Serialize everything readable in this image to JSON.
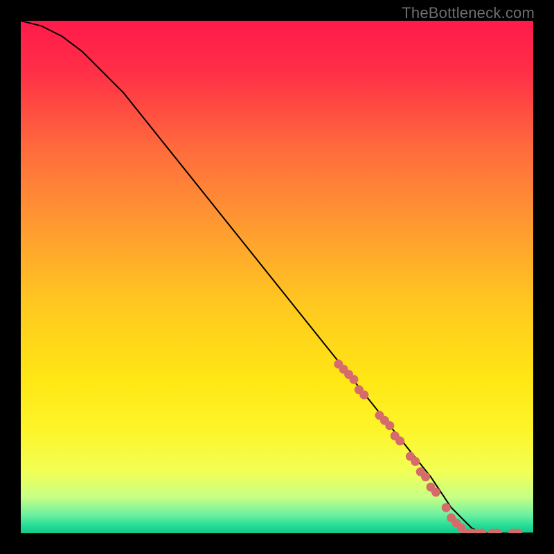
{
  "watermark": "TheBottleneck.com",
  "chart_data": {
    "type": "line",
    "title": "",
    "xlabel": "",
    "ylabel": "",
    "xlim": [
      0,
      100
    ],
    "ylim": [
      0,
      100
    ],
    "grid": false,
    "legend": false,
    "series": [
      {
        "name": "curve",
        "x": [
          0,
          4,
          8,
          12,
          16,
          20,
          24,
          28,
          32,
          36,
          40,
          44,
          48,
          52,
          56,
          60,
          64,
          68,
          72,
          76,
          80,
          82,
          84,
          86,
          88,
          90,
          92,
          94,
          96,
          98,
          100
        ],
        "y": [
          100,
          99,
          97,
          94,
          90,
          86,
          81,
          76,
          71,
          66,
          61,
          56,
          51,
          46,
          41,
          36,
          31,
          26,
          21,
          16,
          11,
          8,
          5,
          3,
          1,
          0,
          0,
          0,
          0,
          0,
          0
        ]
      }
    ],
    "markers": [
      {
        "x": 62,
        "y": 33
      },
      {
        "x": 63,
        "y": 32
      },
      {
        "x": 64,
        "y": 31
      },
      {
        "x": 65,
        "y": 30
      },
      {
        "x": 66,
        "y": 28
      },
      {
        "x": 67,
        "y": 27
      },
      {
        "x": 70,
        "y": 23
      },
      {
        "x": 71,
        "y": 22
      },
      {
        "x": 72,
        "y": 21
      },
      {
        "x": 73,
        "y": 19
      },
      {
        "x": 74,
        "y": 18
      },
      {
        "x": 76,
        "y": 15
      },
      {
        "x": 77,
        "y": 14
      },
      {
        "x": 78,
        "y": 12
      },
      {
        "x": 79,
        "y": 11
      },
      {
        "x": 80,
        "y": 9
      },
      {
        "x": 81,
        "y": 8
      },
      {
        "x": 83,
        "y": 5
      },
      {
        "x": 84,
        "y": 3
      },
      {
        "x": 85,
        "y": 2
      },
      {
        "x": 86,
        "y": 1
      },
      {
        "x": 87,
        "y": 0
      },
      {
        "x": 88,
        "y": 0
      },
      {
        "x": 89,
        "y": 0
      },
      {
        "x": 90,
        "y": 0
      },
      {
        "x": 92,
        "y": 0
      },
      {
        "x": 93,
        "y": 0
      },
      {
        "x": 96,
        "y": 0
      },
      {
        "x": 97,
        "y": 0
      }
    ],
    "gradient_stops": [
      {
        "pos": 0.0,
        "color": "#ff1a4b"
      },
      {
        "pos": 0.1,
        "color": "#ff2f47"
      },
      {
        "pos": 0.25,
        "color": "#ff6b3c"
      },
      {
        "pos": 0.4,
        "color": "#ff9a31"
      },
      {
        "pos": 0.55,
        "color": "#ffc720"
      },
      {
        "pos": 0.7,
        "color": "#ffe714"
      },
      {
        "pos": 0.8,
        "color": "#fdf52a"
      },
      {
        "pos": 0.88,
        "color": "#f2ff55"
      },
      {
        "pos": 0.93,
        "color": "#c6ff86"
      },
      {
        "pos": 0.965,
        "color": "#6af0a0"
      },
      {
        "pos": 0.985,
        "color": "#26dd97"
      },
      {
        "pos": 1.0,
        "color": "#14c888"
      }
    ],
    "marker_color": "#d66b6b",
    "line_color": "#000000"
  }
}
